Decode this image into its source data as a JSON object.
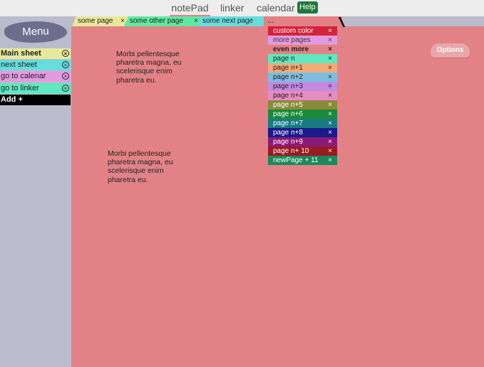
{
  "nav": {
    "notepad": "notePad",
    "linker": "linker",
    "calendar": "calendar",
    "help": "Help"
  },
  "sidebar": {
    "menu": "Menu",
    "close_glyph": "×",
    "items": [
      {
        "label": "Main sheet",
        "color": "#e8e89a",
        "bold": true
      },
      {
        "label": "next sheet",
        "color": "#66dddd"
      },
      {
        "label": "go to calenar",
        "color": "#e49ae0"
      },
      {
        "label": "go to linker",
        "color": "#5fe8be"
      }
    ],
    "add": "Add +"
  },
  "tabs": [
    {
      "label": "some page",
      "close": "×",
      "color": "#e8e89a"
    },
    {
      "label": "some other page",
      "close": "×",
      "color": "#5fe8a0"
    },
    {
      "label": "some next page",
      "close": "",
      "color": "#66dddd"
    }
  ],
  "overflow_tab": "...",
  "dropdown": [
    {
      "label": "custom color",
      "close": "×",
      "bg": "#d4233a",
      "fg": "#ffffff"
    },
    {
      "label": "more pages",
      "close": "×",
      "bg": "#e49ae0",
      "fg": "#333333"
    },
    {
      "label": "even more",
      "close": "×",
      "bg": "#e28286",
      "fg": "#222222",
      "bold": true
    },
    {
      "label": "page n",
      "close": "×",
      "bg": "#5fe8be",
      "fg": "#222222"
    },
    {
      "label": "page n+1",
      "close": "×",
      "bg": "#f2aa78",
      "fg": "#222222"
    },
    {
      "label": "page n+2",
      "close": "×",
      "bg": "#7fbde0",
      "fg": "#222222"
    },
    {
      "label": "page n+3",
      "close": "×",
      "bg": "#c48ae0",
      "fg": "#222222"
    },
    {
      "label": "page n+4",
      "close": "×",
      "bg": "#e88ac4",
      "fg": "#222222"
    },
    {
      "label": "page n+5",
      "close": "×",
      "bg": "#8a8a3c",
      "fg": "#ffffff"
    },
    {
      "label": "page n+6",
      "close": "×",
      "bg": "#1a8a3a",
      "fg": "#ffffff"
    },
    {
      "label": "page n+7",
      "close": "×",
      "bg": "#1a7a82",
      "fg": "#ffffff"
    },
    {
      "label": "page n+8",
      "close": "×",
      "bg": "#1a1a8a",
      "fg": "#ffffff"
    },
    {
      "label": "page n+9",
      "close": "×",
      "bg": "#8a1a7a",
      "fg": "#ffffff"
    },
    {
      "label": "page n+ 10",
      "close": "×",
      "bg": "#9a1a24",
      "fg": "#ffffff"
    },
    {
      "label": "newPage + 11",
      "close": "×",
      "bg": "#1a8a5a",
      "fg": "#ffffff"
    }
  ],
  "options": "Options",
  "notes": [
    "Morbi pellentesque pharetra magna, eu scelerisque enim pharetra eu.",
    "Morbi pellentesque pharetra magna, eu scelerisque enim pharetra eu."
  ]
}
